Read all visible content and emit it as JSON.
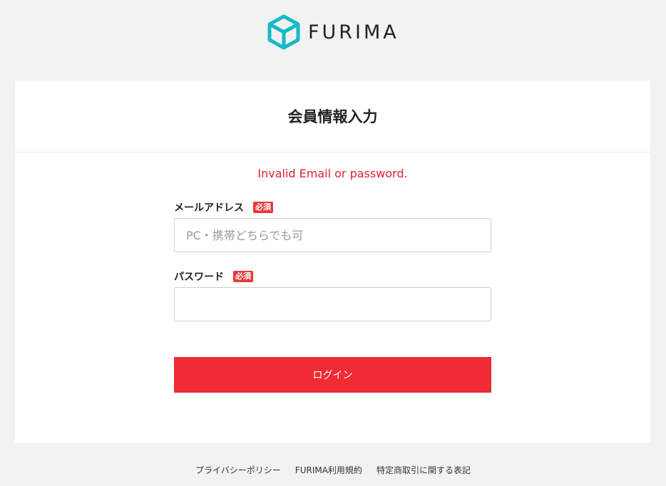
{
  "brand": {
    "name": "FURIMA",
    "logo_color": "#16b9c9",
    "icon": "cube-logo-icon"
  },
  "page": {
    "title": "会員情報入力",
    "error_message": "Invalid Email or password."
  },
  "form": {
    "email": {
      "label": "メールアドレス",
      "required_badge": "必須",
      "placeholder": "PC・携帯どちらでも可",
      "value": ""
    },
    "password": {
      "label": "パスワード",
      "required_badge": "必須",
      "placeholder": "",
      "value": ""
    },
    "submit_label": "ログイン"
  },
  "footer": {
    "links": [
      "プライバシーポリシー",
      "FURIMA利用規約",
      "特定商取引に関する表記"
    ]
  },
  "colors": {
    "accent": "#f02b33",
    "error": "#e0202e",
    "badge": "#e93a3a",
    "background": "#f2f2f2"
  }
}
